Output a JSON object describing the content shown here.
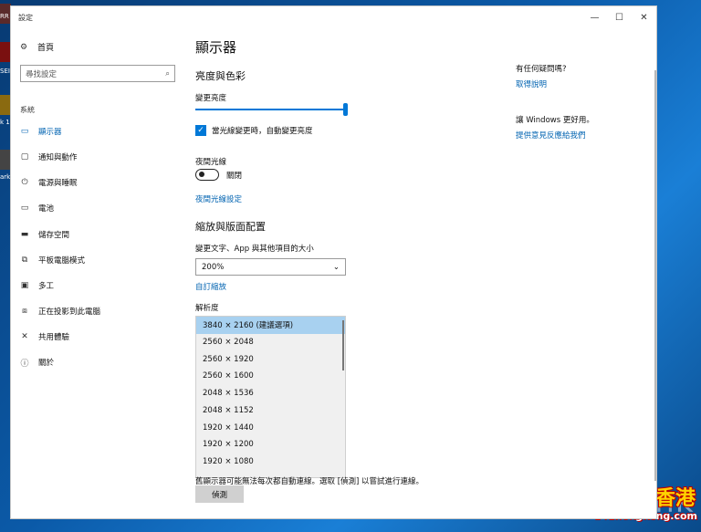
{
  "desktop": {
    "icon_labels": [
      "RR",
      "SEI",
      "k 1",
      "ark"
    ],
    "watermark": "unwire.hk",
    "brand": {
      "main": "一世一香港",
      "sub": "141hongkong.com"
    }
  },
  "window": {
    "title": "設定",
    "controls": {
      "minimize": "—",
      "maximize": "☐",
      "close": "✕"
    }
  },
  "nav": {
    "home": "首頁",
    "search_placeholder": "尋找設定",
    "section": "系統",
    "items": [
      {
        "label": "顯示器",
        "icon": "monitor-icon",
        "active": true
      },
      {
        "label": "通知與動作",
        "icon": "notification-icon",
        "active": false
      },
      {
        "label": "電源與睡眠",
        "icon": "power-icon",
        "active": false
      },
      {
        "label": "電池",
        "icon": "battery-icon",
        "active": false
      },
      {
        "label": "儲存空間",
        "icon": "storage-icon",
        "active": false
      },
      {
        "label": "平板電腦模式",
        "icon": "tablet-icon",
        "active": false
      },
      {
        "label": "多工",
        "icon": "multitask-icon",
        "active": false
      },
      {
        "label": "正在投影到此電腦",
        "icon": "project-icon",
        "active": false
      },
      {
        "label": "共用體驗",
        "icon": "shared-icon",
        "active": false
      },
      {
        "label": "關於",
        "icon": "info-icon",
        "active": false
      }
    ]
  },
  "main": {
    "title": "顯示器",
    "color_heading": "亮度與色彩",
    "brightness_label": "變更亮度",
    "brightness_level": 1.0,
    "auto_brightness_label": "當光線變更時，自動變更亮度",
    "auto_brightness_checked": true,
    "night_light_label": "夜間光線",
    "night_light_state": "關閉",
    "night_light_settings_link": "夜間光線設定",
    "scale_heading": "縮放與版面配置",
    "scale_label": "變更文字、App 與其他項目的大小",
    "scale_value": "200%",
    "custom_scaling_link": "自訂縮放",
    "resolution_label": "解析度",
    "resolutions": [
      "3840 × 2160 (建議選項)",
      "2560 × 2048",
      "2560 × 1920",
      "2560 × 1600",
      "2048 × 1536",
      "2048 × 1152",
      "1920 × 1440",
      "1920 × 1200",
      "1920 × 1080"
    ],
    "selected_resolution_index": 0,
    "detect_hint": "舊顯示器可能無法每次都自動連線。選取 [偵測] 以嘗試進行連線。",
    "detect_button": "偵測"
  },
  "side": {
    "question": "有任何疑問嗎?",
    "help_link": "取得說明",
    "feedback_text": "讓 Windows 更好用。",
    "feedback_link": "提供意見反應給我們"
  }
}
